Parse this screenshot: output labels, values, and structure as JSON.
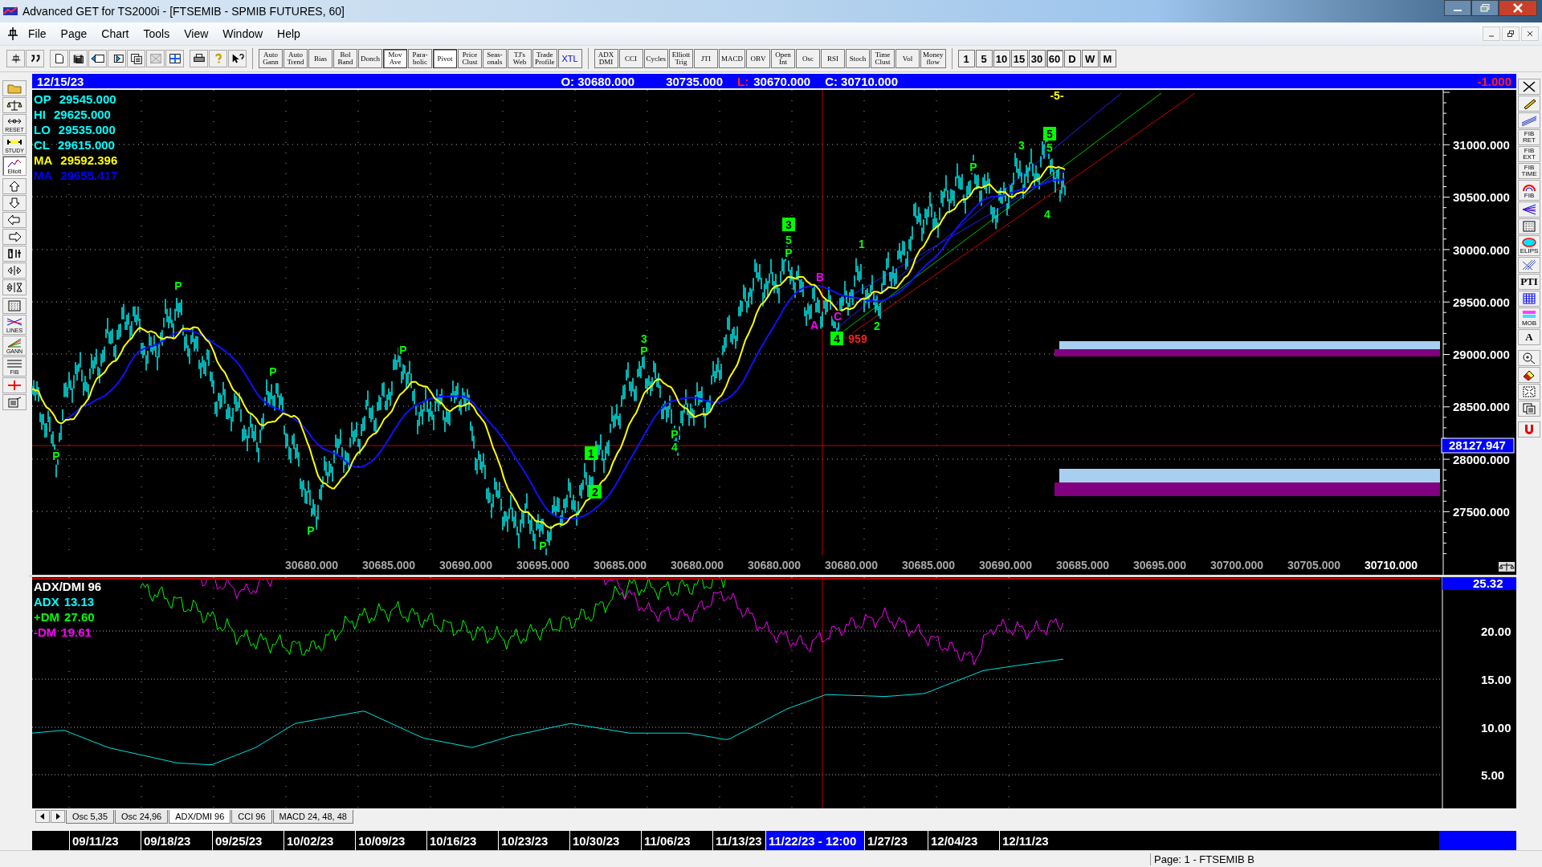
{
  "window": {
    "title": "Advanced GET for TS2000i - [FTSEMIB - SPMIB FUTURES, 60]"
  },
  "menu": [
    "File",
    "Page",
    "Chart",
    "Tools",
    "View",
    "Window",
    "Help"
  ],
  "toolbar": {
    "studies": [
      {
        "label": "Auto\nGann",
        "selected": false
      },
      {
        "label": "Auto\nTrend",
        "selected": false
      },
      {
        "label": "Bias",
        "selected": false
      },
      {
        "label": "Bol\nBand",
        "selected": false
      },
      {
        "label": "Donch",
        "selected": false
      },
      {
        "label": "Mov\nAve",
        "selected": true
      },
      {
        "label": "Para-\nbolic",
        "selected": false
      },
      {
        "label": "Pivot",
        "selected": true
      },
      {
        "label": "Price\nClust",
        "selected": false
      },
      {
        "label": "Seas-\nonals",
        "selected": false
      },
      {
        "label": "TJ's\nWeb",
        "selected": false
      },
      {
        "label": "Trade\nProfile",
        "selected": false
      },
      {
        "label": "XTL",
        "selected": false
      }
    ],
    "indicators": [
      {
        "label": "ADX\nDMI",
        "selected": false
      },
      {
        "label": "CCI",
        "selected": false
      },
      {
        "label": "Cycles",
        "selected": false
      },
      {
        "label": "Elliott\nTrig",
        "selected": false
      },
      {
        "label": "JTI",
        "selected": false
      },
      {
        "label": "MACD",
        "selected": false
      },
      {
        "label": "OBV",
        "selected": false
      },
      {
        "label": "Open\nInt",
        "selected": false
      },
      {
        "label": "Osc",
        "selected": false
      },
      {
        "label": "RSI",
        "selected": false
      },
      {
        "label": "Stoch",
        "selected": false
      },
      {
        "label": "Time\nClust",
        "selected": false
      },
      {
        "label": "Vol",
        "selected": false
      },
      {
        "label": "Money\nflow",
        "selected": false
      }
    ],
    "timeframes": [
      {
        "label": "1",
        "selected": false
      },
      {
        "label": "5",
        "selected": false
      },
      {
        "label": "10",
        "selected": false
      },
      {
        "label": "15",
        "selected": false
      },
      {
        "label": "30",
        "selected": false
      },
      {
        "label": "60",
        "selected": true
      },
      {
        "label": "D",
        "selected": false
      },
      {
        "label": "W",
        "selected": false
      },
      {
        "label": "M",
        "selected": false
      }
    ]
  },
  "left_toolbar": [
    {
      "kind": "folder",
      "selected": false
    },
    {
      "kind": "scales",
      "selected": false
    },
    {
      "kind": "reset",
      "label": "RESET",
      "selected": false
    },
    {
      "kind": "study",
      "label": "STUDY",
      "selected": false
    },
    {
      "kind": "elliott",
      "label": "Elliott",
      "selected": true
    },
    {
      "kind": "up",
      "selected": false
    },
    {
      "kind": "down",
      "selected": false
    },
    {
      "kind": "left",
      "selected": false
    },
    {
      "kind": "right",
      "selected": false
    },
    {
      "kind": "compress",
      "selected": false
    },
    {
      "kind": "hzoom",
      "selected": false
    },
    {
      "kind": "vzoom",
      "selected": false
    },
    {
      "kind": "grid",
      "selected": false
    },
    {
      "kind": "lines",
      "label": "LINES",
      "selected": false
    },
    {
      "kind": "gann",
      "label": "GANN",
      "selected": false
    },
    {
      "kind": "fib",
      "label": "FIB",
      "selected": false
    },
    {
      "kind": "cross",
      "selected": false
    },
    {
      "kind": "notes",
      "selected": false
    }
  ],
  "right_toolbar": [
    {
      "kind": "close"
    },
    {
      "kind": "pencil"
    },
    {
      "kind": "parallel"
    },
    {
      "kind": "text",
      "label": "FIB\nRET"
    },
    {
      "kind": "text",
      "label": "FIB\nEXT"
    },
    {
      "kind": "text",
      "label": "FIB\nTIME"
    },
    {
      "kind": "arc",
      "label": "FIB"
    },
    {
      "kind": "fan"
    },
    {
      "kind": "grid"
    },
    {
      "kind": "ellipse",
      "label": "ELIPS"
    },
    {
      "kind": "diag"
    },
    {
      "kind": "text",
      "label": "PTI"
    },
    {
      "kind": "bluegrid"
    },
    {
      "kind": "mob",
      "label": "MOB"
    },
    {
      "kind": "text",
      "label": "A"
    },
    {
      "kind": "zoom"
    },
    {
      "kind": "eraser"
    },
    {
      "kind": "expand"
    },
    {
      "kind": "copy"
    },
    {
      "kind": "magnet"
    }
  ],
  "info_bar": {
    "date": "12/15/23",
    "open": "O: 30680.000",
    "high": "30735.000",
    "low_label": "L:",
    "low": "30670.000",
    "close": "C: 30710.000",
    "change": "-1.000"
  },
  "price_chart": {
    "legend": [
      {
        "name": "OP",
        "value": "29545.000",
        "color": "#00ffff"
      },
      {
        "name": "HI",
        "value": "29625.000",
        "color": "#00ffff"
      },
      {
        "name": "LO",
        "value": "29535.000",
        "color": "#00ffff"
      },
      {
        "name": "CL",
        "value": "29615.000",
        "color": "#00ffff"
      },
      {
        "name": "MA",
        "value": "29592.396",
        "color": "#ffff00"
      },
      {
        "name": "MA",
        "value": "29655.417",
        "color": "#0000ff"
      }
    ],
    "y_axis": [
      "31000.000",
      "30500.000",
      "30000.000",
      "29500.000",
      "29000.000",
      "28500.000",
      "28000.000",
      "27500.000"
    ],
    "price_marker": "28127.947",
    "x_axis": [
      {
        "label": "30680.000",
        "selected": false
      },
      {
        "label": "30685.000",
        "selected": false
      },
      {
        "label": "30690.000",
        "selected": false
      },
      {
        "label": "30695.000",
        "selected": false
      },
      {
        "label": "30685.000",
        "selected": false
      },
      {
        "label": "30680.000",
        "selected": false
      },
      {
        "label": "30680.000",
        "selected": false
      },
      {
        "label": "30680.000",
        "selected": false
      },
      {
        "label": "30685.000",
        "selected": false
      },
      {
        "label": "30690.000",
        "selected": false
      },
      {
        "label": "30685.000",
        "selected": false
      },
      {
        "label": "30695.000",
        "selected": false
      },
      {
        "label": "30700.000",
        "selected": false
      },
      {
        "label": "30705.000",
        "selected": false
      },
      {
        "label": "30710.000",
        "selected": true
      }
    ],
    "wave_labels": [
      {
        "text": "P",
        "kind": "plain",
        "color": "#00ff00"
      },
      {
        "text": "P",
        "kind": "plain",
        "color": "#00ff00"
      },
      {
        "text": "P",
        "kind": "plain",
        "color": "#00ff00"
      },
      {
        "text": "P",
        "kind": "plain",
        "color": "#00ff00"
      },
      {
        "text": "P",
        "kind": "plain",
        "color": "#00ff00"
      },
      {
        "text": "P",
        "kind": "plain",
        "color": "#00ff00"
      },
      {
        "text": "1",
        "kind": "boxed",
        "color": "#00ff00"
      },
      {
        "text": "2",
        "kind": "boxed",
        "color": "#00ff00"
      },
      {
        "text": "3",
        "kind": "plain",
        "color": "#00ff00"
      },
      {
        "text": "P",
        "kind": "plain",
        "color": "#00ff00"
      },
      {
        "text": "P",
        "kind": "plain",
        "color": "#00ff00"
      },
      {
        "text": "4",
        "kind": "plain",
        "color": "#00ff00"
      },
      {
        "text": "3",
        "kind": "boxed",
        "color": "#00ff00"
      },
      {
        "text": "5",
        "kind": "plain",
        "color": "#00ff00"
      },
      {
        "text": "P",
        "kind": "plain",
        "color": "#00ff00"
      },
      {
        "text": "B",
        "kind": "plain",
        "color": "#ff00ff"
      },
      {
        "text": "A",
        "kind": "plain",
        "color": "#ff00ff"
      },
      {
        "text": "C",
        "kind": "plain",
        "color": "#ff00ff"
      },
      {
        "text": "4",
        "kind": "boxed",
        "color": "#00ff00"
      },
      {
        "text": "959",
        "kind": "plain",
        "color": "#ff2020"
      },
      {
        "text": "1",
        "kind": "plain",
        "color": "#00ff00"
      },
      {
        "text": "2",
        "kind": "plain",
        "color": "#00ff00"
      },
      {
        "text": "P",
        "kind": "plain",
        "color": "#00ff00"
      },
      {
        "text": "3",
        "kind": "plain",
        "color": "#00ff00"
      },
      {
        "text": "5",
        "kind": "boxed",
        "color": "#00ff00"
      },
      {
        "text": "5",
        "kind": "plain",
        "color": "#00ff00"
      },
      {
        "text": "4",
        "kind": "plain",
        "color": "#00ff00"
      },
      {
        "text": "-5-",
        "kind": "plain",
        "color": "#ffff00"
      }
    ]
  },
  "indicator": {
    "legend": [
      {
        "name": "ADX/DMI 96",
        "color": "#ffffff"
      },
      {
        "name": "ADX",
        "value": "13.13",
        "color": "#00ffff"
      },
      {
        "name": "+DM",
        "value": "27.60",
        "color": "#00ff00"
      },
      {
        "name": "-DM",
        "value": "19.61",
        "color": "#ff00ff"
      }
    ],
    "y_axis": [
      "25.32",
      "20.00",
      "15.00",
      "10.00",
      "5.00"
    ]
  },
  "indicator_tabs": [
    {
      "label": "Osc 5,35",
      "selected": false
    },
    {
      "label": "Osc 24,96",
      "selected": false
    },
    {
      "label": "ADX/DMI 96",
      "selected": true
    },
    {
      "label": "CCI 96",
      "selected": false
    },
    {
      "label": "MACD 24, 48, 48",
      "selected": false
    }
  ],
  "date_axis": [
    {
      "label": "09/11/23",
      "selected": false
    },
    {
      "label": "09/18/23",
      "selected": false
    },
    {
      "label": "09/25/23",
      "selected": false
    },
    {
      "label": "10/02/23",
      "selected": false
    },
    {
      "label": "10/09/23",
      "selected": false
    },
    {
      "label": "10/16/23",
      "selected": false
    },
    {
      "label": "10/23/23",
      "selected": false
    },
    {
      "label": "10/30/23",
      "selected": false
    },
    {
      "label": "11/06/23",
      "selected": false
    },
    {
      "label": "11/13/23",
      "selected": false
    },
    {
      "label": "11/22/23 - 12:00",
      "selected": true
    },
    {
      "label": "1/27/23",
      "selected": false
    },
    {
      "label": "12/04/23",
      "selected": false
    },
    {
      "label": "12/11/23",
      "selected": false
    }
  ],
  "status_bar": "Page: 1 - FTSEMIB B"
}
